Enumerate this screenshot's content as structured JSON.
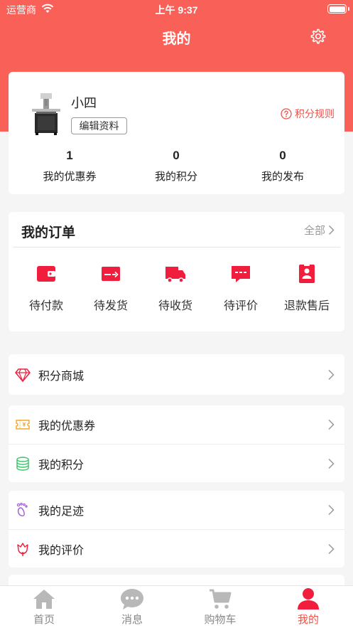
{
  "status_bar": {
    "carrier": "运营商",
    "time": "上午 9:37"
  },
  "header": {
    "title": "我的"
  },
  "profile": {
    "name": "小四",
    "edit_label": "编辑资料",
    "rules_label": "积分规则",
    "stats": [
      {
        "value": "1",
        "label": "我的优惠券"
      },
      {
        "value": "0",
        "label": "我的积分"
      },
      {
        "value": "0",
        "label": "我的发布"
      }
    ]
  },
  "orders": {
    "title": "我的订单",
    "all_label": "全部",
    "items": [
      {
        "label": "待付款",
        "icon": "wallet-icon"
      },
      {
        "label": "待发货",
        "icon": "shipping-card-icon"
      },
      {
        "label": "待收货",
        "icon": "truck-icon"
      },
      {
        "label": "待评价",
        "icon": "comment-icon"
      },
      {
        "label": "退款售后",
        "icon": "refund-icon"
      }
    ]
  },
  "menu_groups": [
    [
      {
        "label": "积分商城",
        "icon": "diamond-icon"
      }
    ],
    [
      {
        "label": "我的优惠券",
        "icon": "coupon-icon"
      },
      {
        "label": "我的积分",
        "icon": "coins-icon"
      }
    ],
    [
      {
        "label": "我的足迹",
        "icon": "footprint-icon"
      },
      {
        "label": "我的评价",
        "icon": "flower-icon"
      }
    ]
  ],
  "tabbar": {
    "items": [
      {
        "label": "首页",
        "icon": "home-icon"
      },
      {
        "label": "消息",
        "icon": "chat-icon"
      },
      {
        "label": "购物车",
        "icon": "cart-icon"
      },
      {
        "label": "我的",
        "icon": "user-icon"
      }
    ],
    "active": "我的"
  },
  "colors": {
    "brand": "#f96057",
    "accent": "#f0524a",
    "icon_red": "#f01e3c"
  }
}
